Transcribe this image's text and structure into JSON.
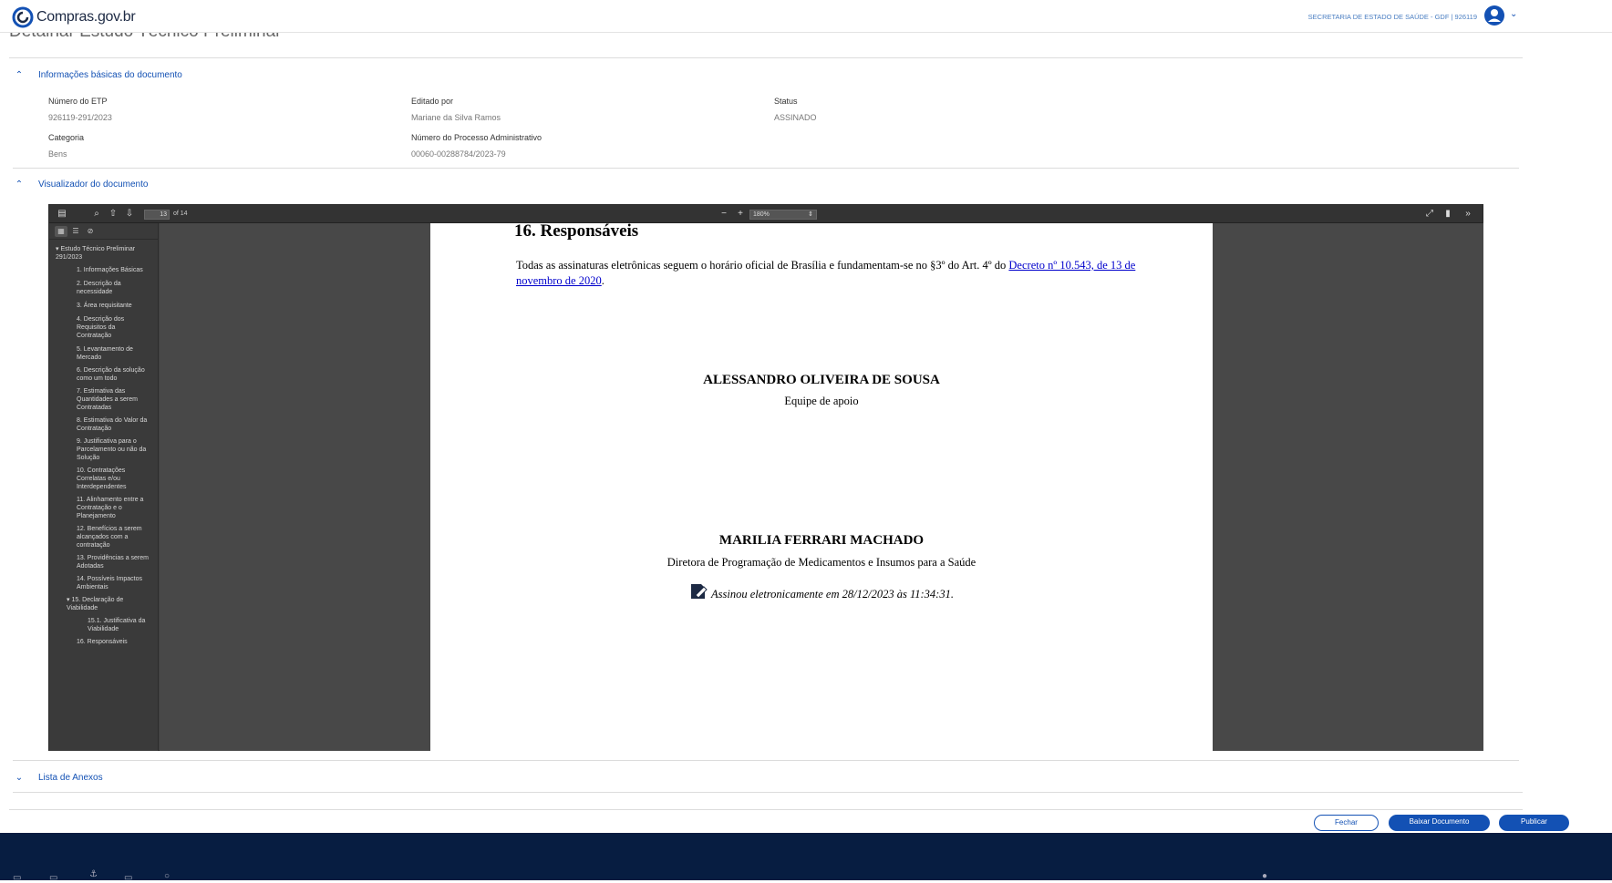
{
  "header": {
    "logo_text": "Compras.gov.br",
    "org_label": "SECRETARIA DE ESTADO DE SAÚDE - GDF | 926119",
    "avatar_icon": "user-circle-icon"
  },
  "page_title": "Detalhar Estudo Técnico Preliminar",
  "section_basic": {
    "title": "Informações básicas do documento",
    "fields": [
      {
        "label": "Número do ETP",
        "value": "926119-291/2023"
      },
      {
        "label": "Editado por",
        "value": "Mariane da Silva Ramos"
      },
      {
        "label": "Status",
        "value": "ASSINADO"
      },
      {
        "label": "Categoria",
        "value": "Bens"
      },
      {
        "label": "Número do Processo Administrativo",
        "value": "00060-00288784/2023-79"
      }
    ]
  },
  "section_viewer": {
    "title": "Visualizador do documento"
  },
  "viewer": {
    "page_number": "13",
    "page_count": "of 14",
    "zoom": "180%",
    "outline": [
      "Estudo Técnico Preliminar 291/2023",
      "1. Informações Básicas",
      "2. Descrição da necessidade",
      "3. Área requisitante",
      "4. Descrição dos Requisitos da Contratação",
      "5. Levantamento de Mercado",
      "6. Descrição da solução como um todo",
      "7. Estimativa das Quantidades a serem Contratadas",
      "8. Estimativa do Valor da Contratação",
      "9. Justificativa para o Parcelamento ou não da Solução",
      "10. Contratações Correlatas e/ou Interdependentes",
      "11. Alinhamento entre a Contratação e o Planejamento",
      "12. Benefícios a serem alcançados com a contratação",
      "13. Providências a serem Adotadas",
      "14. Possíveis Impactos Ambientais",
      "15. Declaração de Viabilidade",
      "15.1. Justificativa da Viabilidade",
      "16. Responsáveis"
    ],
    "pdf": {
      "heading": "16. Responsáveis",
      "paragraph": "Todas as assinaturas eletrônicas seguem o horário oficial de Brasília e fundamentam-se no §3º do Art. 4º do",
      "link": "Decreto nº 10.543, de 13 de novembro de 2020",
      "period": ".",
      "signer1_name": "ALESSANDRO OLIVEIRA DE SOUSA",
      "signer1_role": "Equipe de apoio",
      "signer2_name": "MARILIA FERRARI MACHADO",
      "signer2_role": "Diretora de Programação de Medicamentos e Insumos para a Saúde",
      "signer2_stamp": "Assinou eletronicamente em 28/12/2023 às 11:34:31."
    }
  },
  "section_annex": {
    "title": "Lista de Anexos"
  },
  "actions": {
    "close": "Fechar",
    "download": "Baixar Documento",
    "publish": "Publicar"
  },
  "colors": {
    "primary": "#1351b4",
    "footer": "#071d41"
  }
}
